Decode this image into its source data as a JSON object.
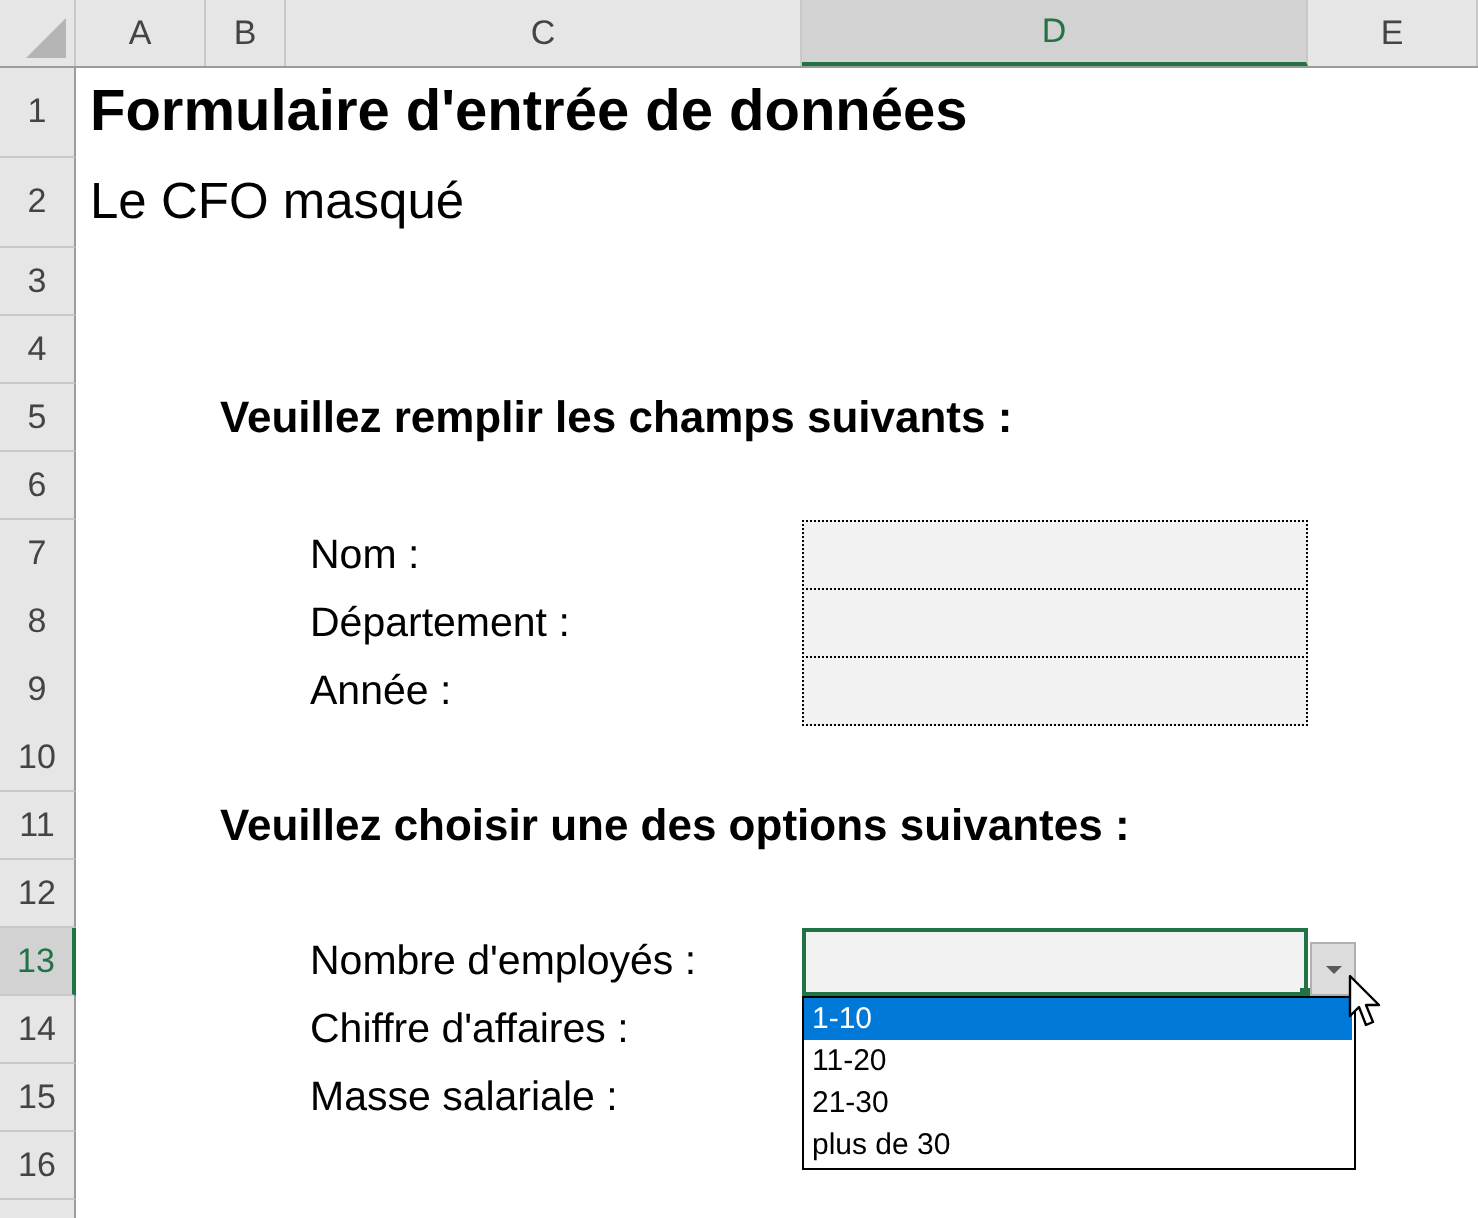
{
  "column_headers": [
    {
      "label": "A",
      "selected": false
    },
    {
      "label": "B",
      "selected": false
    },
    {
      "label": "C",
      "selected": false
    },
    {
      "label": "D",
      "selected": true
    },
    {
      "label": "E",
      "selected": false
    }
  ],
  "rows": [
    {
      "header": "1",
      "selected": false,
      "kind": "title",
      "text": "Formulaire d'entrée de données"
    },
    {
      "header": "2",
      "selected": false,
      "kind": "subtitle",
      "text": "Le CFO masqué"
    },
    {
      "header": "3",
      "selected": false,
      "kind": "empty"
    },
    {
      "header": "4",
      "selected": false,
      "kind": "empty"
    },
    {
      "header": "5",
      "selected": false,
      "kind": "heading",
      "text": "Veuillez remplir les champs suivants :"
    },
    {
      "header": "6",
      "selected": false,
      "kind": "empty"
    },
    {
      "header": "7",
      "selected": false,
      "kind": "input",
      "label": "Nom :"
    },
    {
      "header": "8",
      "selected": false,
      "kind": "input",
      "label": "Département :"
    },
    {
      "header": "9",
      "selected": false,
      "kind": "input",
      "label": "Année :"
    },
    {
      "header": "10",
      "selected": false,
      "kind": "empty"
    },
    {
      "header": "11",
      "selected": false,
      "kind": "heading",
      "text": "Veuillez choisir une des options suivantes :"
    },
    {
      "header": "12",
      "selected": false,
      "kind": "empty"
    },
    {
      "header": "13",
      "selected": true,
      "kind": "dropdown",
      "label": "Nombre d'employés :",
      "active": true,
      "open": true,
      "options": [
        {
          "label": "1-10",
          "selected": true
        },
        {
          "label": "11-20",
          "selected": false
        },
        {
          "label": "21-30",
          "selected": false
        },
        {
          "label": "plus de 30",
          "selected": false
        }
      ]
    },
    {
      "header": "14",
      "selected": false,
      "kind": "label",
      "label": "Chiffre d'affaires :"
    },
    {
      "header": "15",
      "selected": false,
      "kind": "label",
      "label": "Masse salariale :"
    },
    {
      "header": "16",
      "selected": false,
      "kind": "empty"
    }
  ]
}
